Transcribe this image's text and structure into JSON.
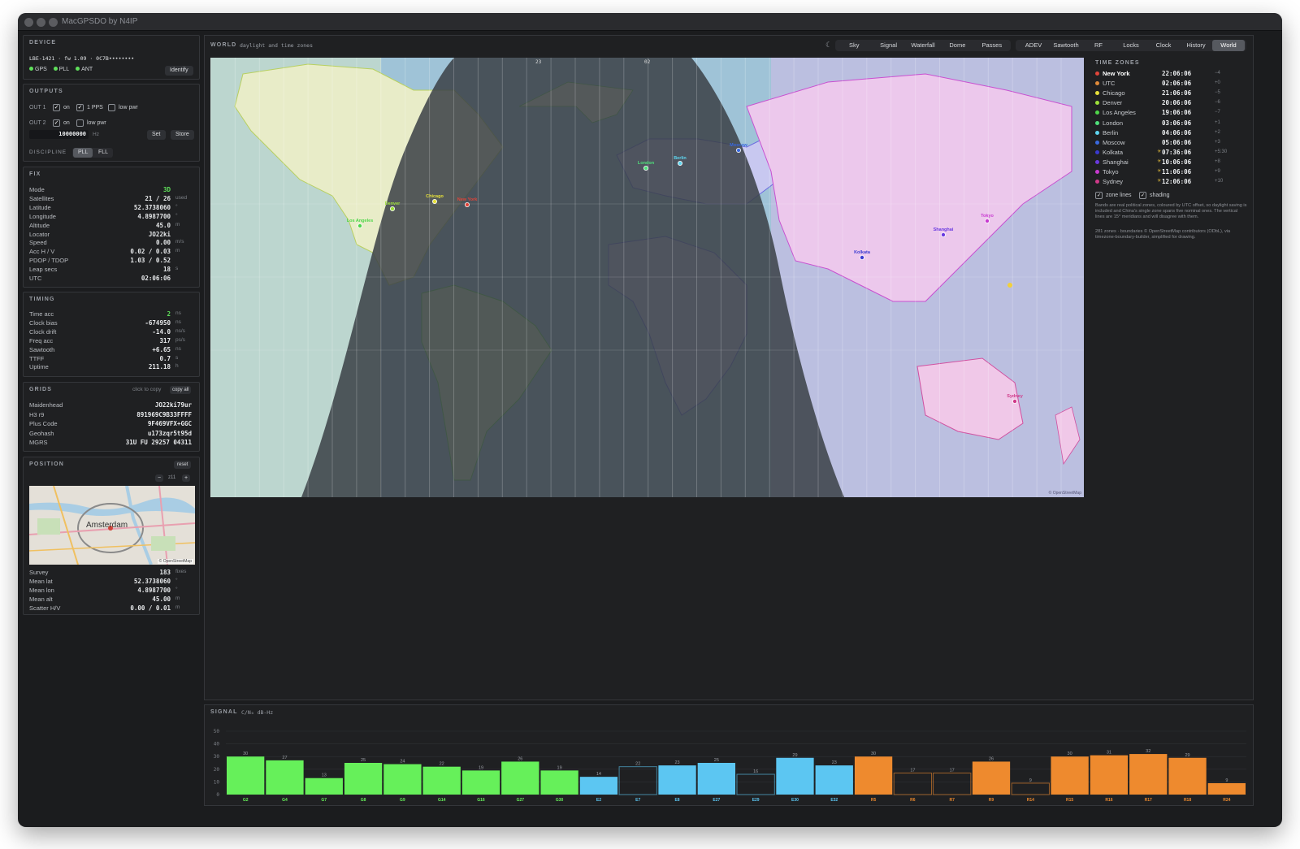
{
  "window": {
    "title": "MacGPSDO by N4IP"
  },
  "device": {
    "title": "DEVICE",
    "info": "LBE-1421 · fw 1.09 · 0C7B••••••••",
    "status": [
      {
        "label": "GPS"
      },
      {
        "label": "PLL"
      },
      {
        "label": "ANT"
      }
    ],
    "identify_label": "Identify"
  },
  "outputs": {
    "title": "OUTPUTS",
    "out1_label": "OUT 1",
    "out2_label": "OUT 2",
    "on_label": "on",
    "pps_label": "1 PPS",
    "low_pwr_label": "low pwr",
    "frequency": "10000000",
    "freq_unit": "Hz",
    "set_label": "Set",
    "store_label": "Store",
    "discipline_label": "DISCIPLINE",
    "pll_label": "PLL",
    "fll_label": "FLL"
  },
  "fix": {
    "title": "FIX",
    "rows": [
      {
        "k": "Mode",
        "v": "3D",
        "u": ""
      },
      {
        "k": "Satellites",
        "v": "21 / 26",
        "u": "used"
      },
      {
        "k": "Latitude",
        "v": "52.3738060",
        "u": "°"
      },
      {
        "k": "Longitude",
        "v": "4.8987700",
        "u": "°"
      },
      {
        "k": "Altitude",
        "v": "45.0",
        "u": "m"
      },
      {
        "k": "Locator",
        "v": "JO22ki",
        "u": ""
      },
      {
        "k": "Speed",
        "v": "0.00",
        "u": "m/s"
      },
      {
        "k": "Acc H / V",
        "v": "0.02 / 0.03",
        "u": "m"
      },
      {
        "k": "PDOP / TDOP",
        "v": "1.03 / 0.52",
        "u": ""
      },
      {
        "k": "Leap secs",
        "v": "18",
        "u": "s"
      },
      {
        "k": "UTC",
        "v": "02:06:06",
        "u": ""
      }
    ]
  },
  "timing": {
    "title": "TIMING",
    "rows": [
      {
        "k": "Time acc",
        "v": "2",
        "u": "ns"
      },
      {
        "k": "Clock bias",
        "v": "-674950",
        "u": "ns"
      },
      {
        "k": "Clock drift",
        "v": "-14.0",
        "u": "ns/s"
      },
      {
        "k": "Freq acc",
        "v": "317",
        "u": "ps/s"
      },
      {
        "k": "Sawtooth",
        "v": "+6.65",
        "u": "ns"
      },
      {
        "k": "TTFF",
        "v": "0.7",
        "u": "s"
      },
      {
        "k": "Uptime",
        "v": "211.18",
        "u": "h"
      }
    ]
  },
  "grids": {
    "title": "GRIDS",
    "hint": "click to copy",
    "copy_all_label": "copy all",
    "rows": [
      {
        "k": "Maidenhead",
        "v": "JO22ki79ur"
      },
      {
        "k": "H3 r9",
        "v": "891969C9B33FFFF"
      },
      {
        "k": "Plus Code",
        "v": "9F469VFX+GGC"
      },
      {
        "k": "Geohash",
        "v": "u173zqr5t95d"
      },
      {
        "k": "MGRS",
        "v": "31U FU 29257 04311"
      }
    ]
  },
  "position": {
    "title": "POSITION",
    "reset_label": "reset",
    "zoom_minus": "−",
    "zoom_level": "z11",
    "zoom_plus": "+",
    "map_city": "Amsterdam",
    "map_credit": "© OpenStreetMap",
    "rows": [
      {
        "k": "Survey",
        "v": "183",
        "u": "fixes"
      },
      {
        "k": "Mean lat",
        "v": "52.3738060",
        "u": "°"
      },
      {
        "k": "Mean lon",
        "v": "4.8987700",
        "u": "°"
      },
      {
        "k": "Mean alt",
        "v": "45.00",
        "u": "m"
      },
      {
        "k": "Scatter H/V",
        "v": "0.00 / 0.01",
        "u": "m"
      }
    ]
  },
  "world": {
    "title": "WORLD",
    "subtitle": "daylight and time zones",
    "tabs_group1": [
      "Sky",
      "Signal",
      "Waterfall",
      "Dome",
      "Passes"
    ],
    "tabs_group2": [
      "ADEV",
      "Sawtooth",
      "RF",
      "Locks",
      "Clock",
      "History",
      "World"
    ],
    "active_tab": "World",
    "map_credit": "© OpenStreetMap",
    "top_labels": [
      "23",
      "02"
    ],
    "cities": [
      {
        "name": "Los Angeles",
        "color": "#4fd64a"
      },
      {
        "name": "Denver",
        "color": "#9de03a"
      },
      {
        "name": "Chicago",
        "color": "#e6e03a"
      },
      {
        "name": "New York",
        "color": "#e0453a"
      },
      {
        "name": "London",
        "color": "#4fe07a"
      },
      {
        "name": "Berlin",
        "color": "#5fd6f0"
      },
      {
        "name": "Moscow",
        "color": "#3a6ae0"
      },
      {
        "name": "Kolkata",
        "color": "#3a3ad0"
      },
      {
        "name": "Shanghai",
        "color": "#6a3ae0"
      },
      {
        "name": "Tokyo",
        "color": "#c83ad0"
      },
      {
        "name": "Sydney",
        "color": "#d03a8a"
      }
    ]
  },
  "timezones": {
    "title": "TIME ZONES",
    "rows": [
      {
        "name": "New York",
        "time": "22:06:06",
        "offset": "−4",
        "star": "",
        "color": "#e0453a"
      },
      {
        "name": "UTC",
        "time": "02:06:06",
        "offset": "+0",
        "star": "",
        "color": "#e08a3a"
      },
      {
        "name": "Chicago",
        "time": "21:06:06",
        "offset": "−5",
        "star": "",
        "color": "#e6e03a"
      },
      {
        "name": "Denver",
        "time": "20:06:06",
        "offset": "−6",
        "star": "",
        "color": "#9de03a"
      },
      {
        "name": "Los Angeles",
        "time": "19:06:06",
        "offset": "−7",
        "star": "",
        "color": "#4fd64a"
      },
      {
        "name": "London",
        "time": "03:06:06",
        "offset": "+1",
        "star": "",
        "color": "#4fe07a"
      },
      {
        "name": "Berlin",
        "time": "04:06:06",
        "offset": "+2",
        "star": "",
        "color": "#5fd6f0"
      },
      {
        "name": "Moscow",
        "time": "05:06:06",
        "offset": "+3",
        "star": "",
        "color": "#3a6ae0"
      },
      {
        "name": "Kolkata",
        "time": "07:36:06",
        "offset": "+5:30",
        "star": "☀",
        "color": "#3a3ad0"
      },
      {
        "name": "Shanghai",
        "time": "10:06:06",
        "offset": "+8",
        "star": "☀",
        "color": "#6a3ae0"
      },
      {
        "name": "Tokyo",
        "time": "11:06:06",
        "offset": "+9",
        "star": "☀",
        "color": "#c83ad0"
      },
      {
        "name": "Sydney",
        "time": "12:06:06",
        "offset": "+10",
        "star": "☀",
        "color": "#d03a8a"
      }
    ],
    "zone_lines_label": "zone lines",
    "shading_label": "shading",
    "note": "Bands are real political zones, coloured by UTC offset, so daylight saving is included and China's single zone spans five nominal ones. The vertical lines are 15° meridians and will disagree with them.",
    "credit": "281 zones · boundaries © OpenStreetMap contributors (ODbL), via timezone-boundary-builder, simplified for drawing."
  },
  "signal": {
    "title": "SIGNAL",
    "unit": "C/N₀ dB-Hz"
  },
  "chart_data": {
    "type": "bar",
    "ylim": [
      0,
      50
    ],
    "yticks": [
      0,
      10,
      20,
      30,
      40,
      50
    ],
    "grid": true,
    "categories": [
      "G2",
      "G4",
      "G7",
      "G8",
      "G9",
      "G14",
      "G16",
      "G27",
      "G30",
      "E2",
      "E7",
      "E8",
      "E27",
      "E29",
      "E30",
      "E32",
      "R5",
      "R6",
      "R7",
      "R9",
      "R14",
      "R15",
      "R16",
      "R17",
      "R18",
      "R24"
    ],
    "values": [
      30,
      27,
      13,
      25,
      24,
      22,
      19,
      26,
      19,
      14,
      22,
      23,
      25,
      16,
      29,
      23,
      30,
      17,
      17,
      26,
      9,
      30,
      31,
      32,
      29,
      9
    ],
    "used": [
      true,
      true,
      true,
      true,
      true,
      true,
      true,
      true,
      true,
      true,
      false,
      true,
      true,
      false,
      true,
      true,
      true,
      false,
      false,
      true,
      false,
      true,
      true,
      true,
      true,
      true
    ],
    "colors": {
      "G": "#66f05a",
      "E": "#5cc6f2",
      "R": "#ee8a2e"
    }
  }
}
